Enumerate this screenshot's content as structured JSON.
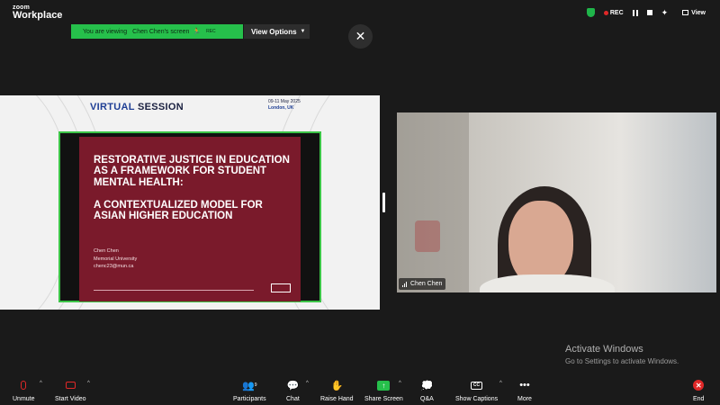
{
  "app": {
    "logo_top": "zoom",
    "logo_bottom": "Workplace"
  },
  "top_right": {
    "rec_label": "REC",
    "view_label": "View"
  },
  "banner": {
    "viewing_text": "You are viewing",
    "sharer_name": "Chen Chen's screen",
    "rec_label": "REC",
    "view_options_label": "View Options"
  },
  "close_label": "✕",
  "shared_screen": {
    "header_bold": "VIRTUAL",
    "header_rest": "SESSION",
    "date_line": "09-11 May 2025",
    "location": "London, UK",
    "slide": {
      "title": "RESTORATIVE JUSTICE IN EDUCATION AS A FRAMEWORK FOR STUDENT MENTAL HEALTH:",
      "subtitle": "A CONTEXTUALIZED MODEL FOR ASIAN HIGHER EDUCATION",
      "author": "Chen Chen",
      "institution": "Memorial University",
      "email": "chenc23@mun.ca"
    }
  },
  "video": {
    "participant_name": "Chen Chen"
  },
  "watermark": {
    "title": "Activate Windows",
    "subtitle": "Go to Settings to activate Windows."
  },
  "toolbar": {
    "unmute": "Unmute",
    "start_video": "Start Video",
    "participants": "Participants",
    "participants_count": "9",
    "chat": "Chat",
    "raise_hand": "Raise Hand",
    "share_screen": "Share Screen",
    "qa": "Q&A",
    "show_captions": "Show Captions",
    "more": "More",
    "end": "End"
  },
  "colors": {
    "banner_green": "#26c04b",
    "rec_red": "#e02828",
    "slide_maroon": "#7a1a2b",
    "virtual_blue": "#1f3f95"
  },
  "icons": [
    "shield-icon",
    "record-icon",
    "pause-icon",
    "stop-icon",
    "sparkle-icon",
    "view-grid-icon",
    "close-icon",
    "signal-icon",
    "mic-muted-icon",
    "camera-off-icon",
    "participants-icon",
    "chat-icon",
    "raise-hand-icon",
    "share-screen-icon",
    "qa-icon",
    "captions-icon",
    "more-icon",
    "end-icon"
  ]
}
